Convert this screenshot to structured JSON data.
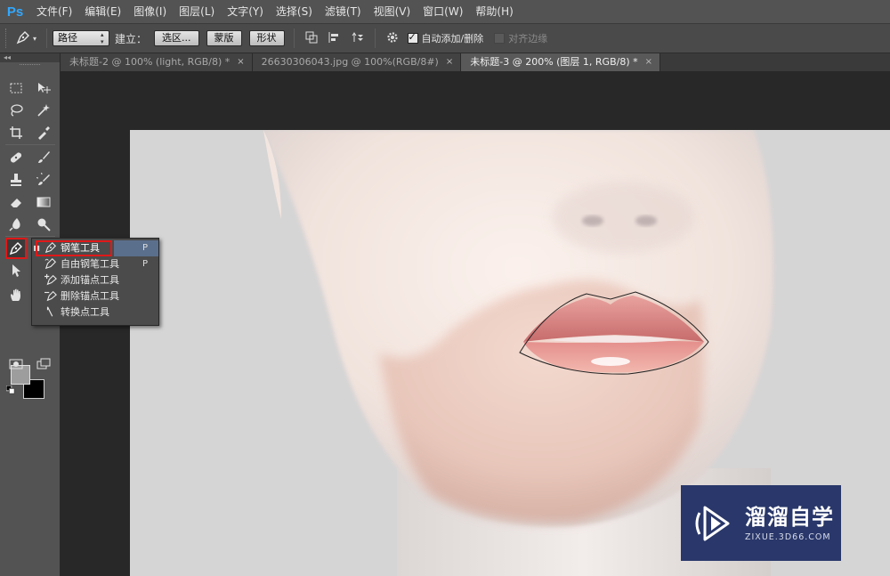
{
  "app": {
    "logo": "Ps"
  },
  "menubar": {
    "items": [
      "文件(F)",
      "编辑(E)",
      "图像(I)",
      "图层(L)",
      "文字(Y)",
      "选择(S)",
      "滤镜(T)",
      "视图(V)",
      "窗口(W)",
      "帮助(H)"
    ]
  },
  "options": {
    "mode_select": "路径",
    "build_label": "建立：",
    "selection_button": "选区...",
    "mask_button": "蒙版",
    "shape_button": "形状",
    "auto_add_delete": {
      "label": "自动添加/删除",
      "checked": true
    },
    "align_edges": {
      "label": "对齐边缘",
      "checked": false
    }
  },
  "tabs": [
    {
      "label": "未标题-2 @ 100% (light, RGB/8) *",
      "active": false
    },
    {
      "label": "26630306043.jpg @ 100%(RGB/8#)",
      "active": false
    },
    {
      "label": "未标题-3 @ 200% (图层 1, RGB/8) *",
      "active": true
    }
  ],
  "tabs_close_glyph": "×",
  "toolbox": {
    "collapse_glyph": "◂◂"
  },
  "flyout": {
    "items": [
      {
        "label": "钢笔工具",
        "key": "P",
        "icon": "pen-icon",
        "active": true
      },
      {
        "label": "自由钢笔工具",
        "key": "P",
        "icon": "freeform-pen-icon",
        "active": false
      },
      {
        "label": "添加锚点工具",
        "key": "",
        "icon": "add-anchor-icon",
        "active": false
      },
      {
        "label": "删除锚点工具",
        "key": "",
        "icon": "delete-anchor-icon",
        "active": false
      },
      {
        "label": "转换点工具",
        "key": "",
        "icon": "convert-point-icon",
        "active": false
      }
    ]
  },
  "watermark": {
    "name": "溜溜自学",
    "url": "ZIXUE.3D66.COM"
  },
  "colors": {
    "accent_red": "#e01818",
    "ps_blue": "#31a8ff",
    "watermark_bg": "#29376a",
    "foreground_swatch": "#9d9d9d",
    "background_swatch": "#000000"
  }
}
